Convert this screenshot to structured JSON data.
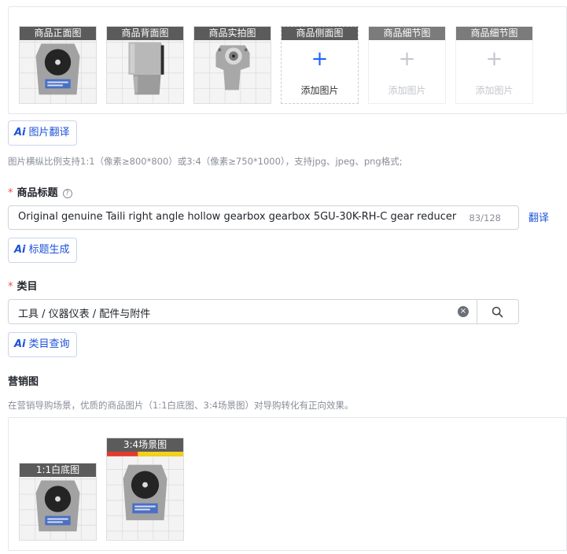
{
  "image_slots": [
    {
      "tag": "商品正面图",
      "state": "filled",
      "add_label": ""
    },
    {
      "tag": "商品背面图",
      "state": "filled",
      "add_label": ""
    },
    {
      "tag": "商品实拍图",
      "state": "filled",
      "add_label": ""
    },
    {
      "tag": "商品侧面图",
      "state": "empty",
      "add_label": "添加图片"
    },
    {
      "tag": "商品细节图",
      "state": "disabled",
      "add_label": "添加图片"
    },
    {
      "tag": "商品细节图",
      "state": "disabled",
      "add_label": "添加图片"
    }
  ],
  "plus_glyph": "+",
  "ai_badge": "Ai",
  "image_translate_btn": "图片翻译",
  "image_hint": "图片横纵比例支持1:1（像素≥800*800）或3:4（像素≥750*1000），支持jpg、jpeg、png格式;",
  "title_field": {
    "required_mark": "*",
    "label": "商品标题",
    "help_glyph": "?",
    "value": "Original genuine Taili right angle hollow gearbox gearbox 5GU-30K-RH-C gear reducer",
    "counter": "83/128",
    "translate_link": "翻译",
    "ai_generate_btn": "标题生成"
  },
  "category_field": {
    "required_mark": "*",
    "label": "类目",
    "value": "工具 / 仪器仪表 / 配件与附件",
    "clear_glyph": "×",
    "ai_query_btn": "类目查询"
  },
  "marketing": {
    "label": "营销图",
    "hint": "在营销导购场景，优质的商品图片（1:1白底图、3:4场景图）对导购转化有正向效果。",
    "white_bg_tag": "1:1白底图",
    "scene_tag": "3:4场景图"
  },
  "colors": {
    "accent": "#1e53d8",
    "plus_blue": "#1966ff",
    "required": "#f54a45",
    "tag_bg": "#5b5b5b"
  }
}
